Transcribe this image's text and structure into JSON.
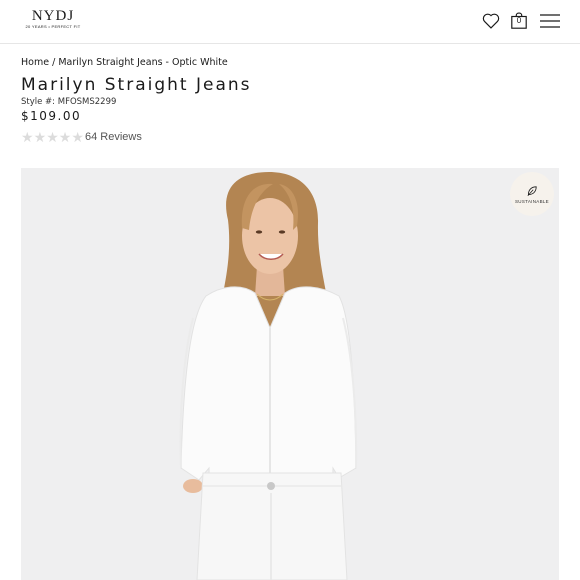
{
  "header": {
    "logo_main": "NYDJ",
    "logo_tagline": "20 YEARS • PERFECT FIT",
    "bag_count": "0",
    "icons": [
      "heart-icon",
      "shopping-bag-icon",
      "hamburger-menu-icon"
    ]
  },
  "breadcrumb": {
    "home": "Home",
    "separator": " / ",
    "current": "Marilyn Straight Jeans - Optic White"
  },
  "product": {
    "title": "Marilyn Straight Jeans",
    "style_number": "Style #: MFOSMS2299",
    "price": "$109.00",
    "rating_value": 0,
    "rating_max": 5,
    "reviews": "64 Reviews"
  },
  "image": {
    "badge_label": "SUSTAINABLE",
    "background": "#efeff0"
  }
}
